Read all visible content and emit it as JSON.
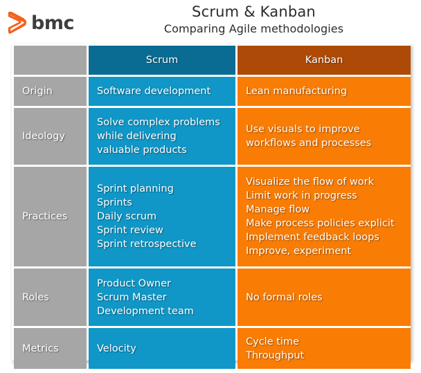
{
  "brand": {
    "logo_text": "bmc",
    "logo_mark_icon": "bmc-chevron-logo-icon",
    "logo_mark_color": "#f4611a"
  },
  "header": {
    "title": "Scrum & Kanban",
    "subtitle": "Comparing Agile methodologies"
  },
  "colors": {
    "label_gray": "#a6a6a6",
    "scrum_header_blue": "#0a6c92",
    "scrum_body_blue": "#1097c7",
    "kanban_header_brown": "#ae4a07",
    "kanban_body_orange": "#f97c05",
    "background": "#ffffff",
    "title_text": "#2b2b2b",
    "cell_text": "#ffffff"
  },
  "table": {
    "columns": [
      "",
      "Scrum",
      "Kanban"
    ],
    "rows": [
      {
        "label": "Origin",
        "scrum": "Software development",
        "kanban": "Lean manufacturing"
      },
      {
        "label": "Ideology",
        "scrum": "Solve complex problems\nwhile delivering\nvaluable products",
        "kanban": "Use visuals to improve\nworkflows and processes"
      },
      {
        "label": "Practices",
        "scrum": "Sprint planning\nSprints\nDaily scrum\nSprint review\nSprint retrospective",
        "kanban": "Visualize the flow of work\nLimit work in progress\nManage flow\nMake process policies explicit\nImplement feedback loops\nImprove, experiment"
      },
      {
        "label": "Roles",
        "scrum": "Product Owner\nScrum Master\nDevelopment team",
        "kanban": "No formal roles"
      },
      {
        "label": "Metrics",
        "scrum": "Velocity",
        "kanban": "Cycle time\nThroughput"
      }
    ]
  }
}
